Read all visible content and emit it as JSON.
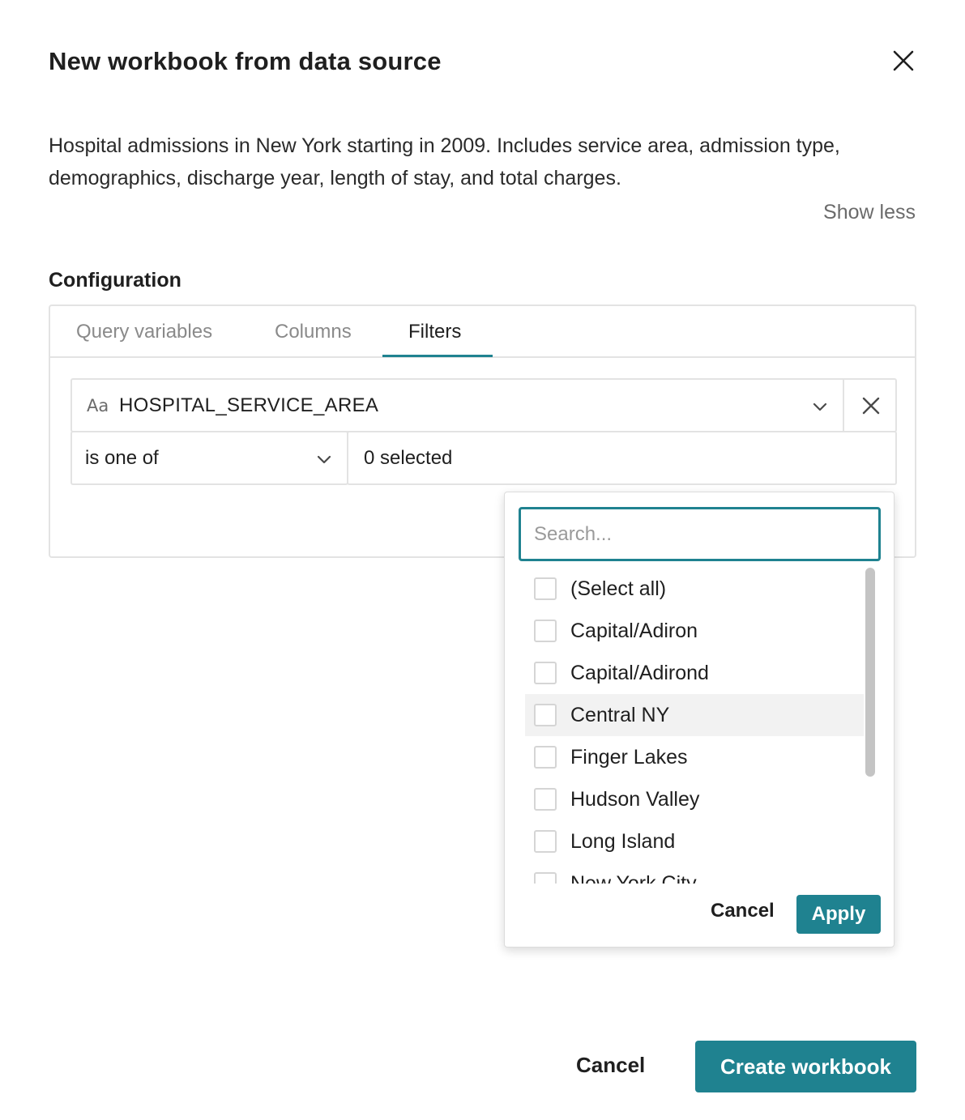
{
  "dialog": {
    "title": "New workbook from data source",
    "description": "Hospital admissions in New York starting in 2009. Includes service area, admission type, demographics, discharge year, length of stay, and total charges.",
    "show_less_label": "Show less",
    "configuration_label": "Configuration",
    "close_icon": "close-icon"
  },
  "tabs": [
    {
      "label": "Query variables",
      "active": false
    },
    {
      "label": "Columns",
      "active": false
    },
    {
      "label": "Filters",
      "active": true
    }
  ],
  "filter": {
    "field_type_icon": "Aa",
    "field_name": "HOSPITAL_SERVICE_AREA",
    "operator": "is one of",
    "values_summary": "0 selected"
  },
  "popup": {
    "search_placeholder": "Search...",
    "items": [
      {
        "label": "(Select all)",
        "checked": false
      },
      {
        "label": "Capital/Adiron",
        "checked": false
      },
      {
        "label": "Capital/Adirond",
        "checked": false
      },
      {
        "label": "Central NY",
        "checked": false,
        "hovered": true
      },
      {
        "label": "Finger Lakes",
        "checked": false
      },
      {
        "label": "Hudson Valley",
        "checked": false
      },
      {
        "label": "Long Island",
        "checked": false
      },
      {
        "label": "New York City",
        "checked": false
      }
    ],
    "cancel_label": "Cancel",
    "apply_label": "Apply"
  },
  "footer": {
    "cancel_label": "Cancel",
    "create_label": "Create workbook"
  },
  "colors": {
    "accent": "#1f8290",
    "border": "#e3e3e3",
    "muted_text": "#8a8a8a"
  }
}
